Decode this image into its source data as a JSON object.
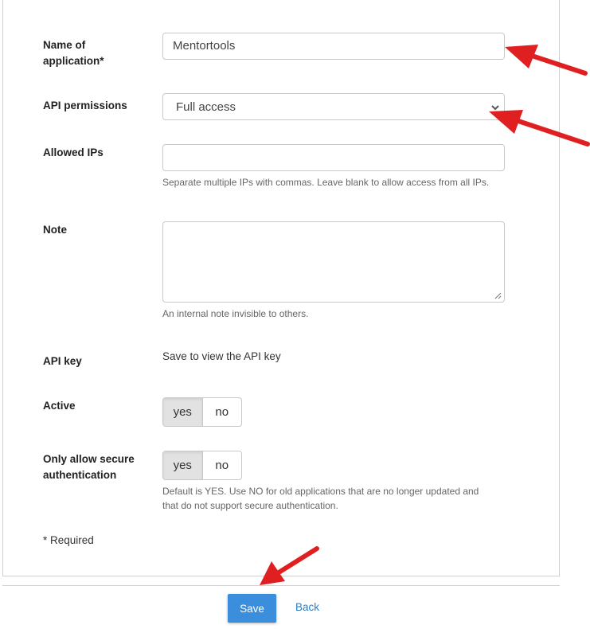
{
  "form": {
    "name": {
      "label_line1": "Name of",
      "label_line2": "application*",
      "value": "Mentortools"
    },
    "permissions": {
      "label": "API permissions",
      "selected": "Full access"
    },
    "allowed_ips": {
      "label": "Allowed IPs",
      "value": "",
      "hint": "Separate multiple IPs with commas. Leave blank to allow access from all IPs."
    },
    "note": {
      "label": "Note",
      "value": "",
      "hint": "An internal note invisible to others."
    },
    "api_key": {
      "label": "API key",
      "text": "Save to view the API key"
    },
    "active": {
      "label": "Active",
      "yes": "yes",
      "no": "no",
      "selected": "yes"
    },
    "secure_auth": {
      "label_line1": "Only allow secure",
      "label_line2": "authentication",
      "yes": "yes",
      "no": "no",
      "selected": "yes",
      "hint_line1": "Default is YES. Use NO for old applications that are no longer updated and",
      "hint_line2": "that do not support secure authentication."
    },
    "required_note": "* Required"
  },
  "actions": {
    "save": "Save",
    "back": "Back"
  },
  "colors": {
    "accent": "#3a8edb",
    "link": "#2a7ec4",
    "annotation_arrow": "#e02020"
  },
  "annotations": {
    "arrow_count": 3,
    "icon": "red-arrow-icon"
  }
}
